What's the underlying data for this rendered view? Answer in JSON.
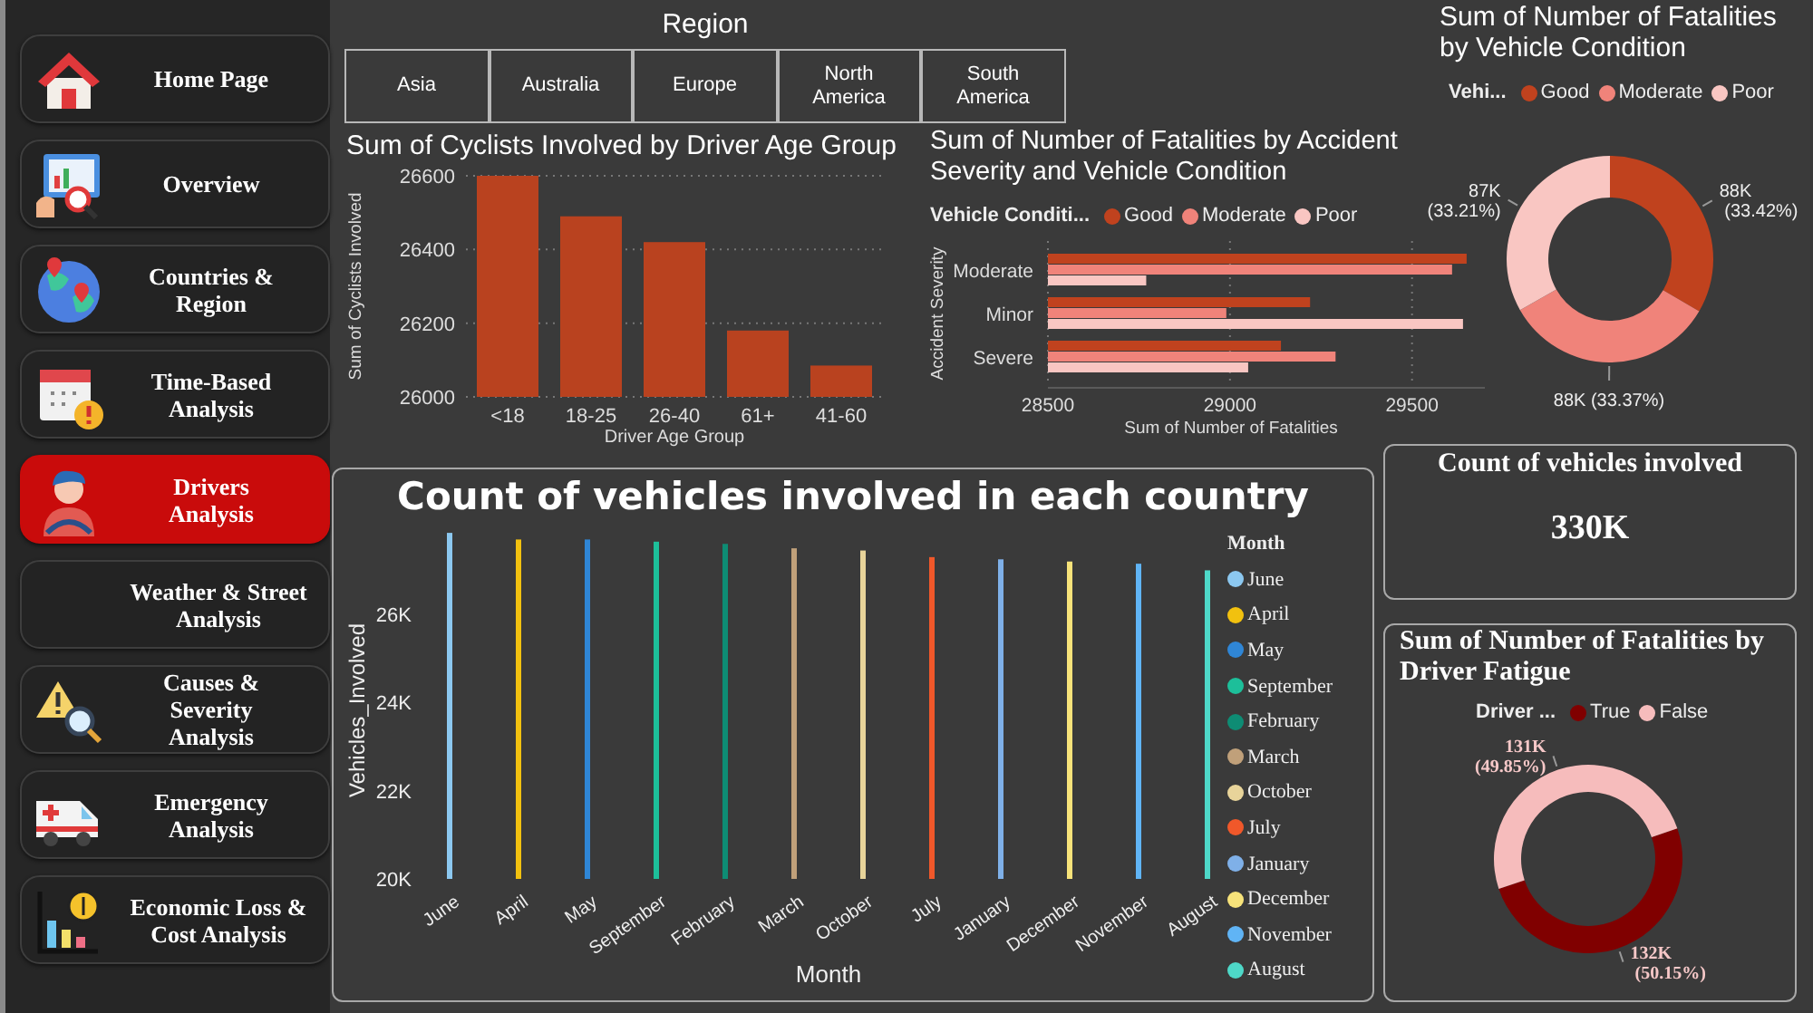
{
  "sidebar": {
    "items": [
      {
        "label": "Home Page",
        "selected": false
      },
      {
        "label": "Overview",
        "selected": false
      },
      {
        "label": "Countries & Region",
        "selected": false
      },
      {
        "label": "Time-Based Analysis",
        "selected": false
      },
      {
        "label": "Drivers Analysis",
        "selected": true
      },
      {
        "label": "Weather & Street Analysis",
        "selected": false
      },
      {
        "label": "Causes & Severity Analysis",
        "selected": false
      },
      {
        "label": "Emergency Analysis",
        "selected": false
      },
      {
        "label": "Economic Loss & Cost Analysis",
        "selected": false
      }
    ]
  },
  "region_slicer": {
    "title": "Region",
    "options": [
      "Asia",
      "Australia",
      "Europe",
      "North America",
      "South America"
    ]
  },
  "cyclists_chart": {
    "chart_data": {
      "type": "bar",
      "title": "Sum of Cyclists Involved by Driver Age Group",
      "xlabel": "Driver Age Group",
      "ylabel": "Sum of Cyclists Involved",
      "categories": [
        "<18",
        "18-25",
        "26-40",
        "61+",
        "41-60"
      ],
      "series": [
        {
          "color": "#b9421f",
          "values": [
            26600,
            26490,
            26420,
            26180,
            26085
          ]
        }
      ],
      "ylim": [
        26000,
        26600
      ],
      "yticks": [
        26000,
        26200,
        26400,
        26600
      ]
    }
  },
  "severity_chart": {
    "legend_title": "Vehicle Conditi...",
    "chart_data": {
      "type": "bar",
      "orientation": "horizontal",
      "title": "Sum of Number of Fatalities by Accident Severity and Vehicle Condition",
      "xlabel": "Sum of Number of Fatalities",
      "ylabel": "Accident Severity",
      "categories": [
        "Moderate",
        "Minor",
        "Severe"
      ],
      "series": [
        {
          "name": "Good",
          "color": "#c0421e",
          "values": [
            29650,
            29220,
            29140
          ]
        },
        {
          "name": "Moderate",
          "color": "#f0837a",
          "values": [
            29610,
            28990,
            29290
          ]
        },
        {
          "name": "Poor",
          "color": "#f9c6c2",
          "values": [
            28770,
            29640,
            29050
          ]
        }
      ],
      "xlim": [
        28500,
        29700
      ],
      "xticks": [
        28500,
        29000,
        29500
      ],
      "stacked": false
    }
  },
  "condition_donut": {
    "legend_title": "Vehi...",
    "chart_data": {
      "type": "donut",
      "title": "Sum of Number of Fatalities by Vehicle Condition",
      "categories": [
        "Good",
        "Moderate",
        "Poor"
      ],
      "values": [
        33.42,
        33.37,
        33.21
      ],
      "colors": [
        "#c0421e",
        "#f0837a",
        "#f9c6c2"
      ],
      "value_labels": [
        "88K (33.42%)",
        "88K (33.37%)",
        "87K (33.21%)"
      ]
    }
  },
  "month_chart": {
    "legend_title": "Month",
    "legend": [
      {
        "label": "June",
        "color": "#8cc8f0"
      },
      {
        "label": "April",
        "color": "#f2c10f"
      },
      {
        "label": "May",
        "color": "#2f86d6"
      },
      {
        "label": "September",
        "color": "#1dbf9a"
      },
      {
        "label": "February",
        "color": "#0e8c74"
      },
      {
        "label": "March",
        "color": "#c0a07a"
      },
      {
        "label": "October",
        "color": "#e8d49a"
      },
      {
        "label": "July",
        "color": "#f0582a"
      },
      {
        "label": "January",
        "color": "#7fb0e8"
      },
      {
        "label": "December",
        "color": "#f7e37a"
      },
      {
        "label": "November",
        "color": "#60b4f5"
      },
      {
        "label": "August",
        "color": "#4ed8c8"
      }
    ],
    "chart_data": {
      "type": "bar",
      "title": "Count of vehicles involved in each country",
      "xlabel": "Month",
      "ylabel": "Vehicles_Involved",
      "categories": [
        "June",
        "April",
        "May",
        "September",
        "February",
        "March",
        "October",
        "July",
        "January",
        "December",
        "November",
        "August"
      ],
      "values": [
        27850,
        27700,
        27700,
        27650,
        27600,
        27500,
        27450,
        27300,
        27250,
        27200,
        27150,
        27000
      ],
      "ylim": [
        20000,
        28000
      ],
      "yticks": [
        {
          "value": 20000,
          "label": "20K"
        },
        {
          "value": 22000,
          "label": "22K"
        },
        {
          "value": 24000,
          "label": "24K"
        },
        {
          "value": 26000,
          "label": "26K"
        }
      ]
    }
  },
  "kpi_card": {
    "title": "Count of vehicles involved",
    "value": "330K"
  },
  "fatigue_donut": {
    "legend_title": "Driver ...",
    "chart_data": {
      "type": "donut",
      "title": "Sum of Number of Fatalities by Driver Fatigue",
      "categories": [
        "True",
        "False"
      ],
      "values": [
        50.15,
        49.85
      ],
      "colors": [
        "#800000",
        "#f6bcbc"
      ],
      "value_labels": [
        "132K (50.15%)",
        "131K (49.85%)"
      ]
    }
  }
}
